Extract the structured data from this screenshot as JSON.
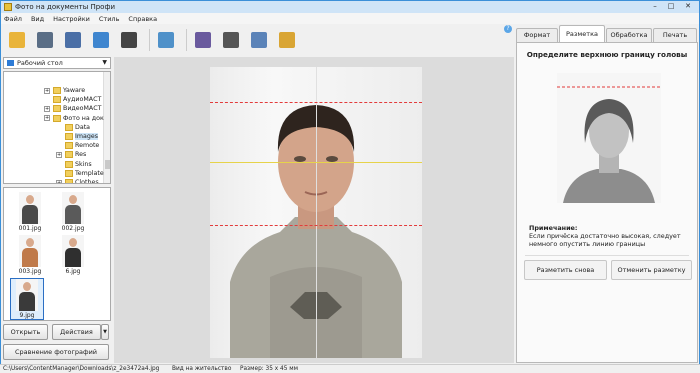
{
  "window": {
    "title": "Фото на документы Профи",
    "minimize": "–",
    "maximize": "□",
    "close": "✕"
  },
  "menu": [
    "Файл",
    "Вид",
    "Настройки",
    "Стиль",
    "Справка"
  ],
  "toolbar": [
    {
      "icon": "open-folder-icon",
      "color": "#e9b43a"
    },
    {
      "icon": "save-disk-icon",
      "color": "#5a6e86"
    },
    {
      "icon": "print-icon",
      "color": "#4b6fa6"
    },
    {
      "icon": "user-settings-icon",
      "color": "#3f86cf"
    },
    {
      "icon": "camera-icon",
      "color": "#444444"
    },
    {
      "icon": "image-edit-icon",
      "color": "#4f91c9"
    },
    {
      "icon": "help-book-icon",
      "color": "#6a5a9e"
    },
    {
      "icon": "video-reel-icon",
      "color": "#555555"
    },
    {
      "icon": "gear-cloud-icon",
      "color": "#5b83b8"
    },
    {
      "icon": "gift-box-icon",
      "color": "#d9a534"
    }
  ],
  "folder_combo": {
    "value": "Рабочий стол"
  },
  "tree": [
    "Yaware",
    "АудиоМАСТ",
    "ВидеоМАСТ",
    "Фото на док",
    "Data",
    "Images",
    "Remote",
    "Res",
    "Skins",
    "Template",
    "Clothes"
  ],
  "thumbs": [
    "001.jpg",
    "002.jpg",
    "003.jpg",
    "6.jpg",
    "9.jpg"
  ],
  "buttons": {
    "open": "Открыть",
    "actions": "Действия",
    "actions_arrow": "▼",
    "compare": "Сравнение фотографий"
  },
  "tabs": [
    "Формат",
    "Разметка",
    "Обработка",
    "Печать"
  ],
  "panel": {
    "heading": "Определите верхнюю границу головы",
    "note_title": "Примечание:",
    "note_text": "Если причёска достаточно высокая, следует немного опустить линию границы",
    "remark_button": "Разметить снова",
    "cancel_button": "Отменить разметку"
  },
  "help_label": "?",
  "status": {
    "path": "C:\\Users\\ContentManager\\Downloads\\z_2e3472a4.jpg",
    "type": "Вид на жительство",
    "size": "Размер: 35 x 45 мм"
  }
}
